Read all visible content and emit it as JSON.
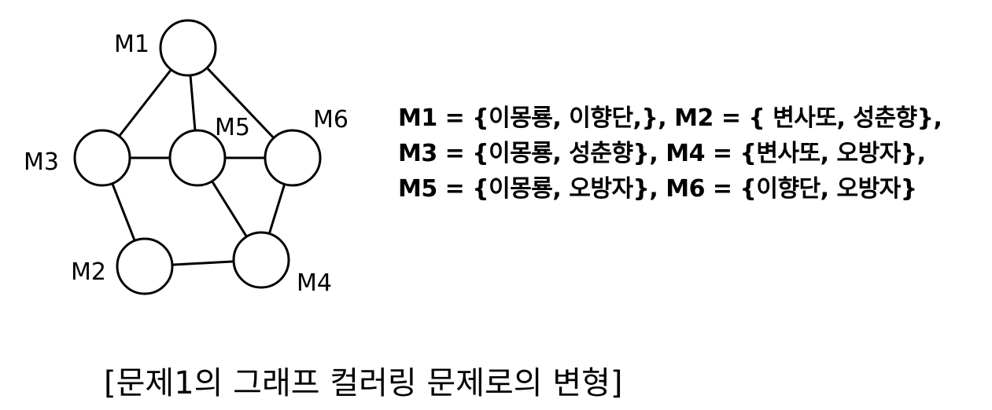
{
  "graph": {
    "nodes": [
      {
        "id": "M1",
        "label": "M1"
      },
      {
        "id": "M2",
        "label": "M2"
      },
      {
        "id": "M3",
        "label": "M3"
      },
      {
        "id": "M4",
        "label": "M4"
      },
      {
        "id": "M5",
        "label": "M5"
      },
      {
        "id": "M6",
        "label": "M6"
      }
    ],
    "edges": [
      [
        "M1",
        "M3"
      ],
      [
        "M1",
        "M5"
      ],
      [
        "M1",
        "M6"
      ],
      [
        "M3",
        "M5"
      ],
      [
        "M5",
        "M6"
      ],
      [
        "M3",
        "M2"
      ],
      [
        "M2",
        "M4"
      ],
      [
        "M5",
        "M4"
      ],
      [
        "M6",
        "M4"
      ]
    ]
  },
  "sets": {
    "line1": "M1 = {이몽룡, 이향단,}, M2 = { 변사또, 성춘향},",
    "line2": "M3 = {이몽룡, 성춘향},  M4 = {변사또, 오방자},",
    "line3": "M5 = {이몽룡, 오방자},  M6 = {이향단, 오방자}"
  },
  "caption": "[문제1의 그래프 컬러링 문제로의 변형]"
}
